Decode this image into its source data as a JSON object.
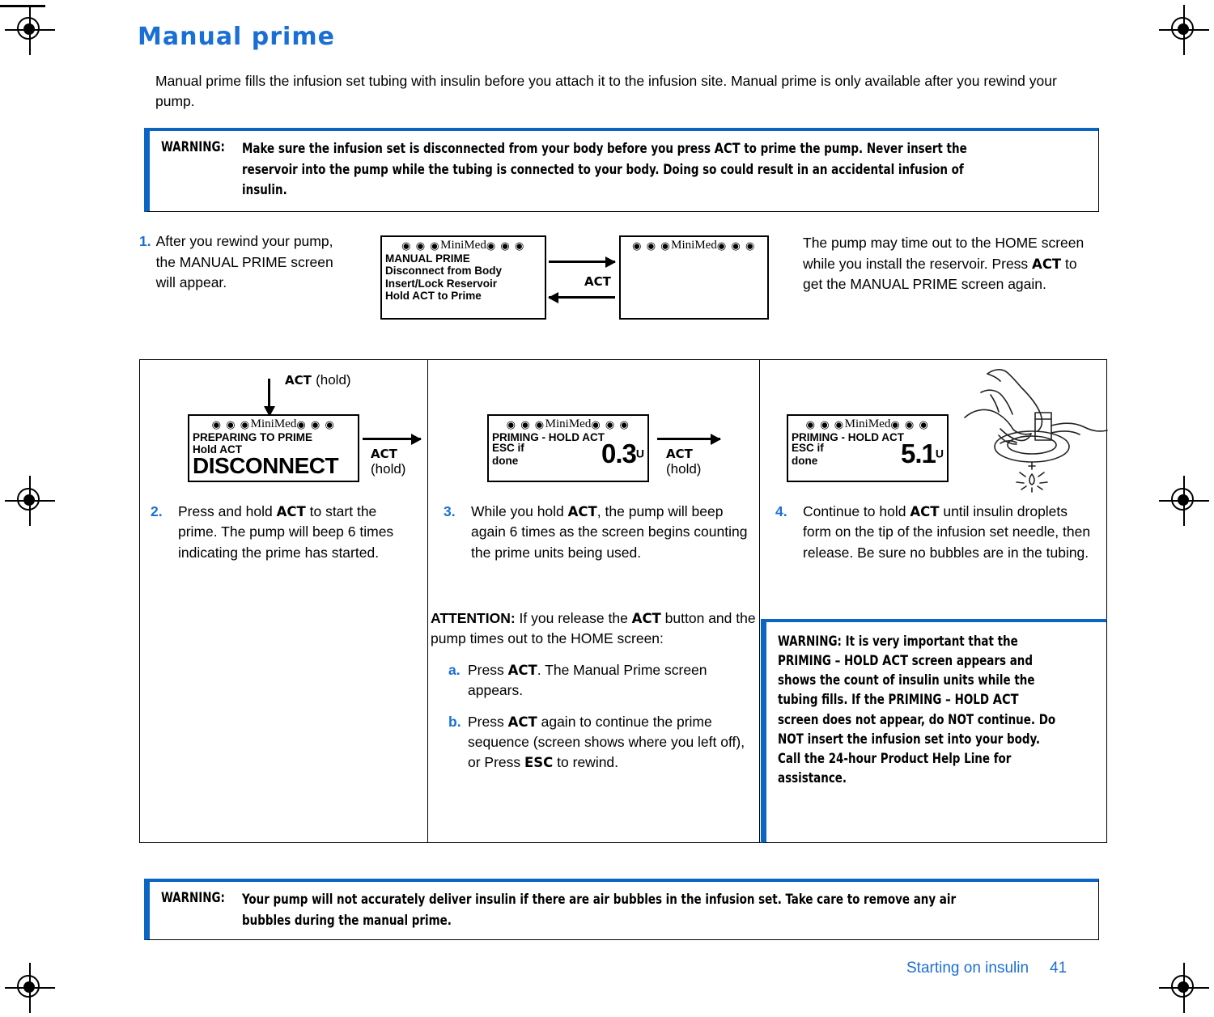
{
  "page": {
    "title": "Manual prime",
    "intro": "Manual prime fills the infusion set tubing with insulin before you attach it to the infusion site. Manual prime is only available after you rewind your pump.",
    "footer_section": "Starting on insulin",
    "footer_page": "41",
    "accent_blue": "#1a6fd4",
    "warning_rule_blue": "#0a66c2"
  },
  "warning_top": {
    "label": "WARNING:",
    "text": "Make sure the infusion set is disconnected from your body before you press ACT to prime the pump. Never insert the reservoir into the pump while the tubing is connected to your body. Doing so could result in an accidental infusion of insulin."
  },
  "warning_bottom": {
    "label": "WARNING:",
    "text": "Your pump will not accurately deliver insulin if there are air bubbles in the infusion set. Take care to remove any air bubbles during the manual prime."
  },
  "step1": {
    "number": "1.",
    "text": "After you rewind your pump, the MANUAL PRIME screen will appear.",
    "note": "The pump may time out to the HOME screen while you install the reservoir. Press ACT to get the MANUAL PRIME screen again.",
    "arrow_label": "ACT"
  },
  "screens": {
    "brand": "MiniMed",
    "manual_prime": {
      "lines": [
        "MANUAL PRIME",
        "Disconnect from Body",
        "Insert/Lock Reservoir",
        "Hold ACT to Prime"
      ]
    },
    "home": {
      "lines": []
    },
    "preparing": {
      "lines": [
        "PREPARING TO PRIME",
        "Hold ACT"
      ],
      "big": "DISCONNECT"
    },
    "priming_low": {
      "title": "PRIMING - HOLD ACT",
      "label_line1": "ESC if",
      "label_line2": "done",
      "value": "0.3",
      "unit": "U"
    },
    "priming_high": {
      "title": "PRIMING - HOLD ACT",
      "label_line1": "ESC if",
      "label_line2": "done",
      "value": "5.1",
      "unit": "U"
    }
  },
  "transitions": {
    "into_preparing": {
      "act": "ACT",
      "hold": "(hold)"
    },
    "prep_to_prime": {
      "act": "ACT",
      "hold": "(hold)"
    },
    "prime_to_prime": {
      "act": "ACT",
      "hold": "(hold)"
    }
  },
  "step2": {
    "number": "2.",
    "text": "Press and hold ACT to start the prime. The pump will beep 6 times indicating the prime has started."
  },
  "step3": {
    "number": "3.",
    "text": "While you hold ACT, the pump will beep again 6 times as the screen begins counting the prime units being used."
  },
  "step4": {
    "number": "4.",
    "text": "Continue to hold ACT until insulin droplets form on the tip of the infusion set needle, then release. Be sure no bubbles are in the tubing."
  },
  "attention": {
    "label": "ATTENTION:",
    "lead": "If you release the ACT button and the pump times out to the HOME screen:",
    "items": [
      {
        "letter": "a.",
        "text": "Press ACT. The Manual Prime screen appears."
      },
      {
        "letter": "b.",
        "text": "Press ACT again to continue the prime sequence (screen shows where you left off), or Press ESC to rewind."
      }
    ]
  },
  "warning_col3": {
    "text": "WARNING: It is very important that the PRIMING – HOLD ACT screen appears and shows the count of insulin units while the tubing fills. If the PRIMING – HOLD ACT screen does not appear, do NOT continue. Do NOT insert the infusion set into your body. Call the 24-hour Product Help Line for assistance."
  }
}
